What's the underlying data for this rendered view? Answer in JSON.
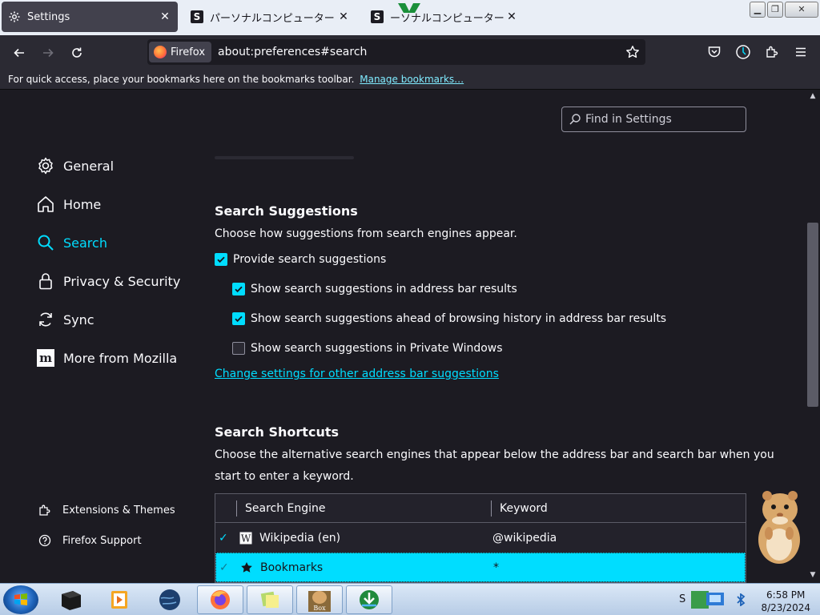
{
  "tabs": [
    {
      "title": "Settings",
      "active": true
    },
    {
      "title": "パーソナルコンピューター VAI",
      "favicon": "S"
    },
    {
      "title": "ーソナルコンピューター VAI",
      "favicon": "S"
    }
  ],
  "nav": {
    "identity_label": "Firefox",
    "url": "about:preferences#search"
  },
  "bookmarks_bar": {
    "text": "For quick access, place your bookmarks here on the bookmarks toolbar.",
    "link": "Manage bookmarks…"
  },
  "find": {
    "placeholder": "Find in Settings"
  },
  "sidebar": {
    "items": [
      {
        "label": "General",
        "icon": "gear-icon"
      },
      {
        "label": "Home",
        "icon": "home-icon"
      },
      {
        "label": "Search",
        "icon": "search-icon",
        "selected": true
      },
      {
        "label": "Privacy & Security",
        "icon": "lock-icon"
      },
      {
        "label": "Sync",
        "icon": "sync-icon"
      },
      {
        "label": "More from Mozilla",
        "icon": "mozilla-icon"
      }
    ],
    "footer": [
      {
        "label": "Extensions & Themes",
        "icon": "puzzle-icon"
      },
      {
        "label": "Firefox Support",
        "icon": "help-icon"
      }
    ]
  },
  "suggestions": {
    "heading": "Search Suggestions",
    "description": "Choose how suggestions from search engines appear.",
    "options": [
      {
        "label": "Provide search suggestions",
        "checked": true
      },
      {
        "label": "Show search suggestions in address bar results",
        "checked": true
      },
      {
        "label": "Show search suggestions ahead of browsing history in address bar results",
        "checked": true
      },
      {
        "label": "Show search suggestions in Private Windows",
        "checked": false
      }
    ],
    "link": "Change settings for other address bar suggestions"
  },
  "shortcuts": {
    "heading": "Search Shortcuts",
    "description_line1": "Choose the alternative search engines that appear below the address bar and search bar when you",
    "description_line2": "start to enter a keyword.",
    "columns": {
      "engine": "Search Engine",
      "keyword": "Keyword"
    },
    "rows": [
      {
        "name": "Wikipedia (en)",
        "keyword": "@wikipedia",
        "icon": "wikipedia-icon",
        "checked": true
      },
      {
        "name": "Bookmarks",
        "keyword": "*",
        "icon": "star-icon",
        "checked": true,
        "selected": true
      }
    ]
  },
  "taskbar": {
    "clock_time": "6:58 PM",
    "clock_date": "8/23/2024",
    "tray_letter": "S"
  }
}
